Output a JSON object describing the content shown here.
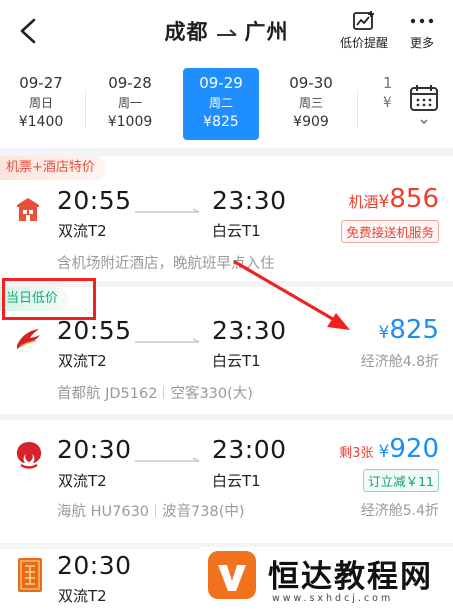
{
  "header": {
    "origin": "成都",
    "destination": "广州",
    "price_alert_label": "低价提醒",
    "more_label": "更多"
  },
  "dates": [
    {
      "date": "09-27",
      "weekday": "周日",
      "price": "¥1400",
      "selected": false
    },
    {
      "date": "09-28",
      "weekday": "周一",
      "price": "¥1009",
      "selected": false
    },
    {
      "date": "09-29",
      "weekday": "周二",
      "price": "¥825",
      "selected": true
    },
    {
      "date": "09-30",
      "weekday": "周三",
      "price": "¥909",
      "selected": false
    },
    {
      "date": "1",
      "weekday": "",
      "price": "¥",
      "selected": false
    }
  ],
  "flights": [
    {
      "tag": "机票+酒店特价",
      "dep_time": "20:55",
      "dep_airport": "双流T2",
      "arr_time": "23:30",
      "arr_airport": "白云T1",
      "price_prefix": "机酒",
      "price_currency": "¥",
      "price": "856",
      "chip": "免费接送机服务",
      "note": "含机场附近酒店，晚航班早点入住"
    },
    {
      "tag": "当日低价",
      "dep_time": "20:55",
      "dep_airport": "双流T2",
      "arr_time": "23:30",
      "arr_airport": "白云T1",
      "price_currency": "¥",
      "price": "825",
      "cabin": "经济舱4.8折",
      "airline": "首都航 JD5162",
      "aircraft": "空客330(大)"
    },
    {
      "dep_time": "20:30",
      "dep_airport": "双流T2",
      "arr_time": "23:00",
      "arr_airport": "白云T1",
      "remaining": "剩3张",
      "price_currency": "¥",
      "price": "920",
      "chip": "订立减￥11",
      "cabin": "经济舱5.4折",
      "airline": "海航 HU7630",
      "aircraft": "波音738(中)"
    },
    {
      "dep_time": "20:30",
      "dep_airport": "双流T2"
    }
  ],
  "watermark": {
    "title": "恒达教程网",
    "url": "www.sxhdcj.com"
  },
  "colors": {
    "accent_blue": "#1f8fff",
    "price_red": "#ef3e2e",
    "discount_green": "#19a877",
    "annotation_red": "#f02121"
  }
}
